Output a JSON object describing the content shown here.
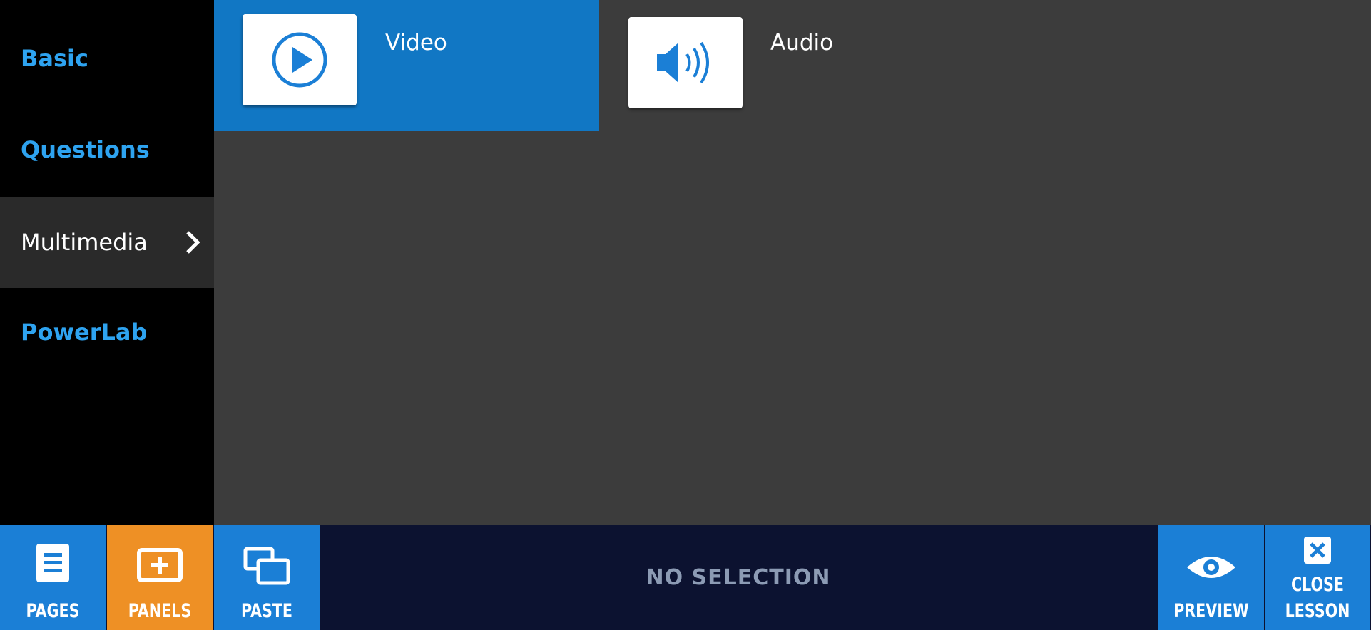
{
  "sidebar": {
    "items": [
      {
        "label": "Basic",
        "active": false
      },
      {
        "label": "Questions",
        "active": false
      },
      {
        "label": "Multimedia",
        "active": true
      },
      {
        "label": "PowerLab",
        "active": false
      }
    ]
  },
  "panels": {
    "tiles": [
      {
        "label": "Video",
        "icon": "play-icon",
        "selected": true
      },
      {
        "label": "Audio",
        "icon": "speaker-icon",
        "selected": false
      }
    ]
  },
  "toolbar": {
    "pages_label": "PAGES",
    "panels_label": "PANELS",
    "paste_label": "PASTE",
    "status_text": "NO SELECTION",
    "preview_label": "PREVIEW",
    "close_label_line1": "CLOSE",
    "close_label_line2": "LESSON"
  },
  "colors": {
    "accent_blue": "#1b7fd6",
    "selected_tile": "#1177c4",
    "active_orange": "#ee9025",
    "sidebar_link": "#2ea3f0",
    "content_bg": "#3c3c3c",
    "toolbar_bg": "#0c1230"
  }
}
